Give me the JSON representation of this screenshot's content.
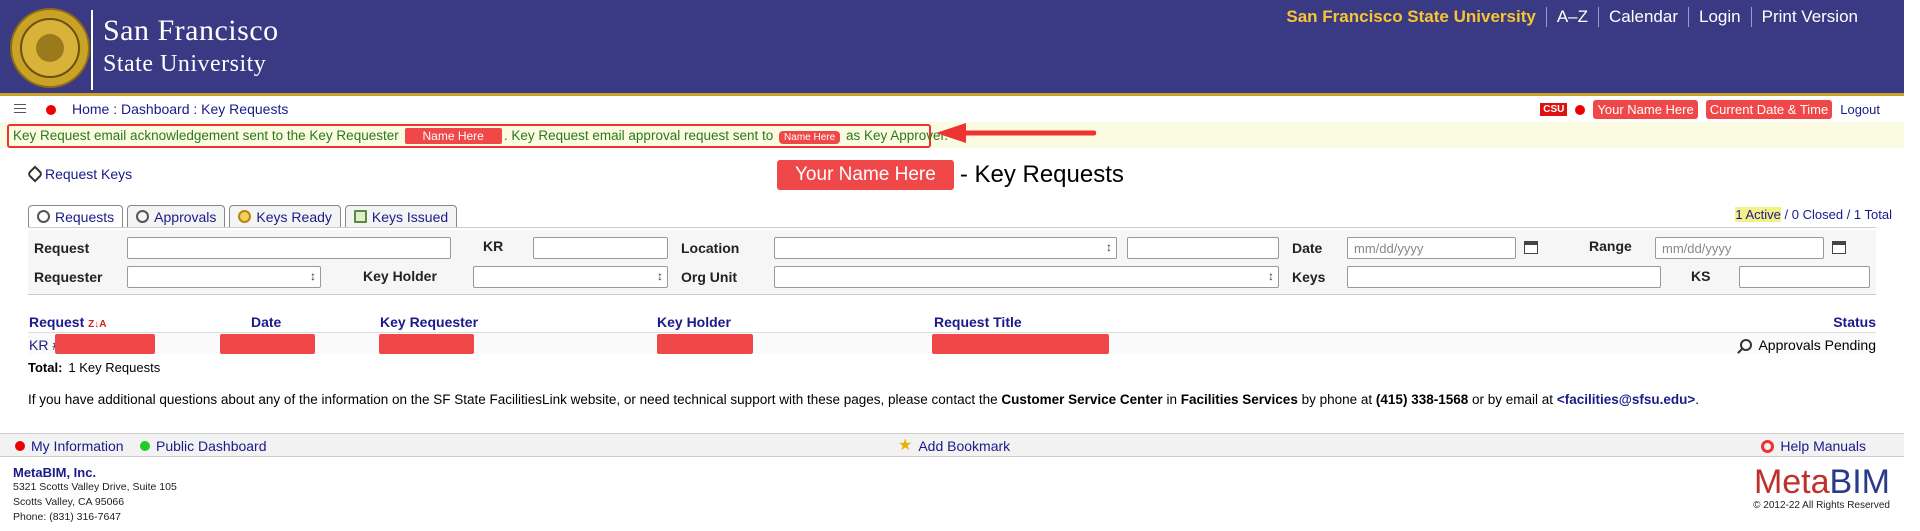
{
  "header": {
    "university_line1": "San Francisco",
    "university_line2": "State University",
    "nav": [
      "San Francisco State University",
      "A–Z",
      "Calendar",
      "Login",
      "Print Version"
    ]
  },
  "subbar": {
    "breadcrumb": "Home : Dashboard : Key Requests",
    "csu_badge": "CSU",
    "user_name": "Your Name Here",
    "datetime": "Current Date & Time",
    "logout": "Logout"
  },
  "message": {
    "part1": "Key Request email acknowledgement sent to the Key Requester",
    "name1": "Name Here",
    "part2": ". Key Request email approval request sent to",
    "name2": "Name Here",
    "part3": "as Key Approver."
  },
  "page": {
    "request_keys_link": "Request Keys",
    "title_name": "Your Name Here",
    "title_suffix": "- Key Requests"
  },
  "tabs": [
    "Requests",
    "Approvals",
    "Keys Ready",
    "Keys Issued"
  ],
  "counts": {
    "active": "1 Active",
    "closed": "/ 0 Closed",
    "total": "/ 1 Total"
  },
  "filters": {
    "request": "Request",
    "kr": "KR",
    "location": "Location",
    "date": "Date",
    "range": "Range",
    "requester": "Requester",
    "key_holder": "Key Holder",
    "org_unit": "Org Unit",
    "keys": "Keys",
    "ks": "KS",
    "date_placeholder": "mm/dd/yyyy",
    "range_placeholder": "mm/dd/yyyy"
  },
  "table": {
    "headers": {
      "request": "Request",
      "sort": "Z↓A",
      "date": "Date",
      "key_requester": "Key Requester",
      "key_holder": "Key Holder",
      "request_title": "Request Title",
      "status": "Status"
    },
    "rows": [
      {
        "kr_prefix": "KR #",
        "status": "Approvals Pending"
      }
    ],
    "total_label": "Total:",
    "total_value": "1 Key Requests"
  },
  "info": {
    "text1": "If you have additional questions about any of the information on the SF State FacilitiesLink website, or need technical support with these pages, please contact the",
    "csc": "Customer Service Center",
    "in": "in",
    "fs": "Facilities Services",
    "by_phone": "by phone at",
    "phone": "(415) 338-1568",
    "or_email": "or by email at",
    "email": "<facilities@sfsu.edu>",
    "end": "."
  },
  "footer": {
    "my_info": "My Information",
    "public_dashboard": "Public Dashboard",
    "add_bookmark": "Add Bookmark",
    "help_manuals": "Help Manuals",
    "company": "MetaBIM, Inc.",
    "address1": "5321 Scotts Valley Drive, Suite 105",
    "address2": "Scotts Valley, CA 95066",
    "phone": "Phone: (831) 316-7647",
    "logo_meta": "Meta",
    "logo_bim": "BIM",
    "copyright": "© 2012-22 All Rights Reserved"
  },
  "colors": {
    "header_bg": "#3a3a84",
    "accent_gold": "#f7c531",
    "redaction": "#f04848",
    "link": "#1a1a8a",
    "message_text": "#2a7a1a"
  }
}
